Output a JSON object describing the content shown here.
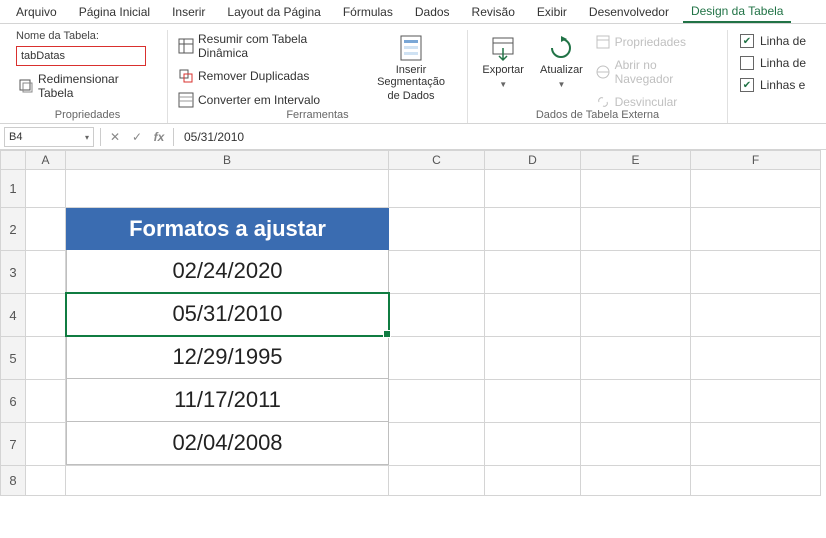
{
  "menu": {
    "items": [
      "Arquivo",
      "Página Inicial",
      "Inserir",
      "Layout da Página",
      "Fórmulas",
      "Dados",
      "Revisão",
      "Exibir",
      "Desenvolvedor",
      "Design da Tabela"
    ],
    "active_index": 9
  },
  "ribbon": {
    "properties": {
      "label_name": "Nome da Tabela:",
      "table_name": "tabDatas",
      "resize_label": "Redimensionar Tabela",
      "group_title": "Propriedades"
    },
    "tools": {
      "summarize": "Resumir com Tabela Dinâmica",
      "remove_dup": "Remover Duplicadas",
      "convert_range": "Converter em Intervalo",
      "slicer_line1": "Inserir Segmentação",
      "slicer_line2": "de Dados",
      "group_title": "Ferramentas"
    },
    "external": {
      "export": "Exportar",
      "refresh": "Atualizar",
      "properties": "Propriedades",
      "open_browser": "Abrir no Navegador",
      "unlink": "Desvincular",
      "group_title": "Dados de Tabela Externa"
    },
    "options": {
      "opt1": "Linha de",
      "opt2": "Linha de",
      "opt3": "Linhas e",
      "chk1": true,
      "chk2": false,
      "chk3": true
    }
  },
  "formula_bar": {
    "name_box": "B4",
    "formula": "05/31/2010"
  },
  "grid": {
    "columns": [
      "A",
      "B",
      "C",
      "D",
      "E",
      "F"
    ],
    "rows": [
      "1",
      "2",
      "3",
      "4",
      "5",
      "6",
      "7",
      "8"
    ]
  },
  "table": {
    "header": "Formatos a ajustar",
    "selected_row_index": 1,
    "data": [
      "02/24/2020",
      "05/31/2010",
      "12/29/1995",
      "11/17/2011",
      "02/04/2008"
    ]
  }
}
